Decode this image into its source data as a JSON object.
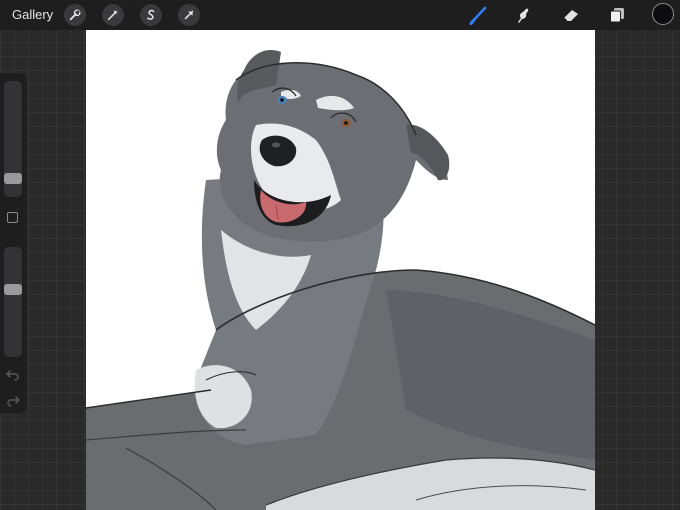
{
  "toolbar": {
    "gallery_label": "Gallery",
    "actions": [
      {
        "name": "actions",
        "icon": "wrench-icon"
      },
      {
        "name": "adjustments",
        "icon": "magic-wand-icon"
      },
      {
        "name": "selection",
        "icon": "selection-s-icon"
      },
      {
        "name": "transform",
        "icon": "arrow-cursor-icon"
      }
    ],
    "tools": [
      {
        "name": "brush",
        "icon": "brush-icon",
        "active": true
      },
      {
        "name": "smudge",
        "icon": "smudge-finger-icon",
        "active": false
      },
      {
        "name": "eraser",
        "icon": "eraser-icon",
        "active": false
      },
      {
        "name": "layers",
        "icon": "layers-icon",
        "active": false
      }
    ],
    "current_color": "#0d0d10",
    "accent_color": "#2f7cf6"
  },
  "sidebar": {
    "brush_size_level": 0.6,
    "opacity_level": 0.4
  },
  "canvas": {
    "background": "#ffffff",
    "subject": "dog-illustration"
  }
}
